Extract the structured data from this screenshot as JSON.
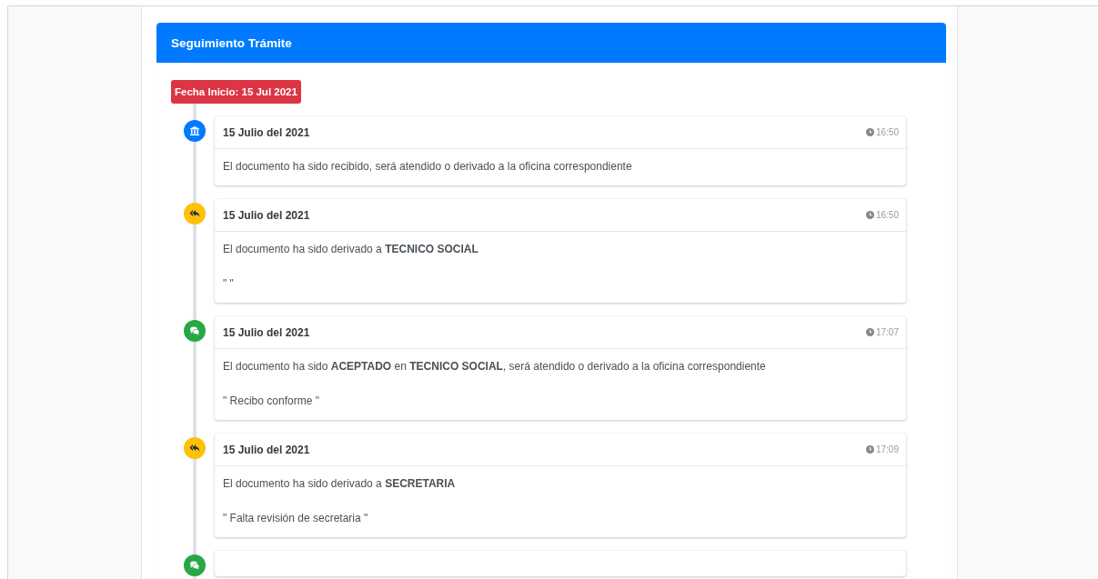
{
  "card": {
    "title": "Seguimiento Trámite"
  },
  "start_badge": "Fecha Inicio: 15 Jul 2021",
  "timeline": [
    {
      "kind": "received",
      "date": "15 Julio del 2021",
      "time": "16:50",
      "message": "El documento ha sido recibido, será atendido o derivado a la oficina correspondiente"
    },
    {
      "kind": "derived",
      "date": "15 Julio del 2021",
      "time": "16:50",
      "message": "El documento ha sido derivado a **TECNICO SOCIAL**",
      "note": "\" \""
    },
    {
      "kind": "accepted",
      "date": "15 Julio del 2021",
      "time": "17:07",
      "message": "El documento ha sido **ACEPTADO** en **TECNICO SOCIAL**, será atendido o derivado a la oficina correspondiente",
      "note": "\" Recibo conforme \""
    },
    {
      "kind": "derived",
      "date": "15 Julio del 2021",
      "time": "17:09",
      "message": "El documento ha sido derivado a **SECRETARIA**",
      "note": "\" Falta revisión de secretaria \""
    },
    {
      "kind": "accepted"
    }
  ]
}
